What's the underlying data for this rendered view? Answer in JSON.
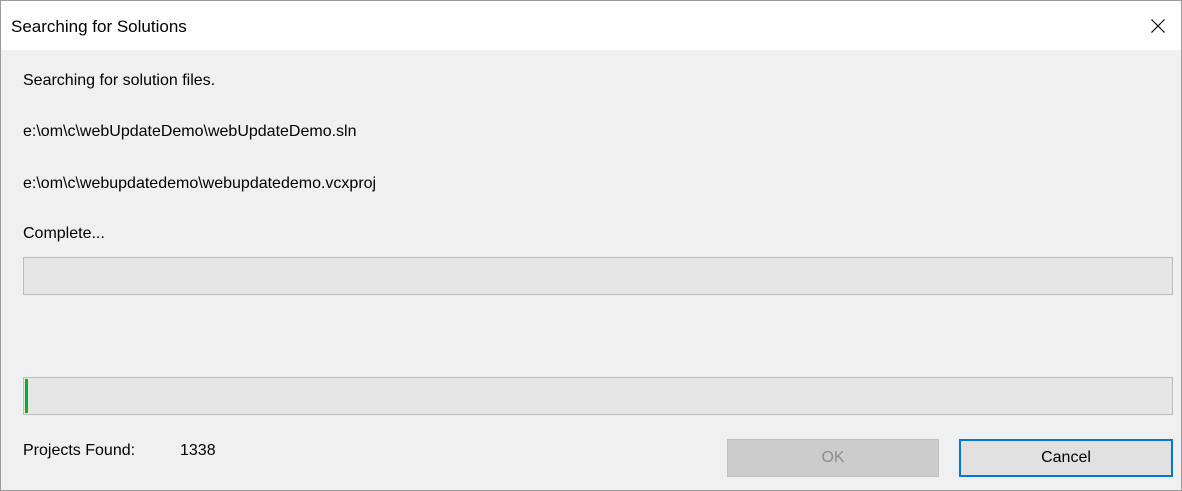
{
  "window": {
    "title": "Searching for Solutions",
    "close_icon": "close-icon"
  },
  "content": {
    "status_text": "Searching for solution files.",
    "file_line_1": "e:\\om\\c\\webUpdateDemo\\webUpdateDemo.sln",
    "file_line_2": "e:\\om\\c\\webupdatedemo\\webupdatedemo.vcxproj",
    "complete_text": "Complete..."
  },
  "progress": {
    "top_bar_fraction": 0,
    "bottom_bar_fraction": 0.003,
    "fill_color": "#06b025"
  },
  "footer": {
    "projects_found_label": "Projects Found:",
    "projects_found_count": "1338"
  },
  "buttons": {
    "ok_label": "OK",
    "ok_enabled": false,
    "cancel_label": "Cancel"
  },
  "colors": {
    "dialog_background": "#f0f0f0",
    "focus_border": "#0078d7"
  }
}
